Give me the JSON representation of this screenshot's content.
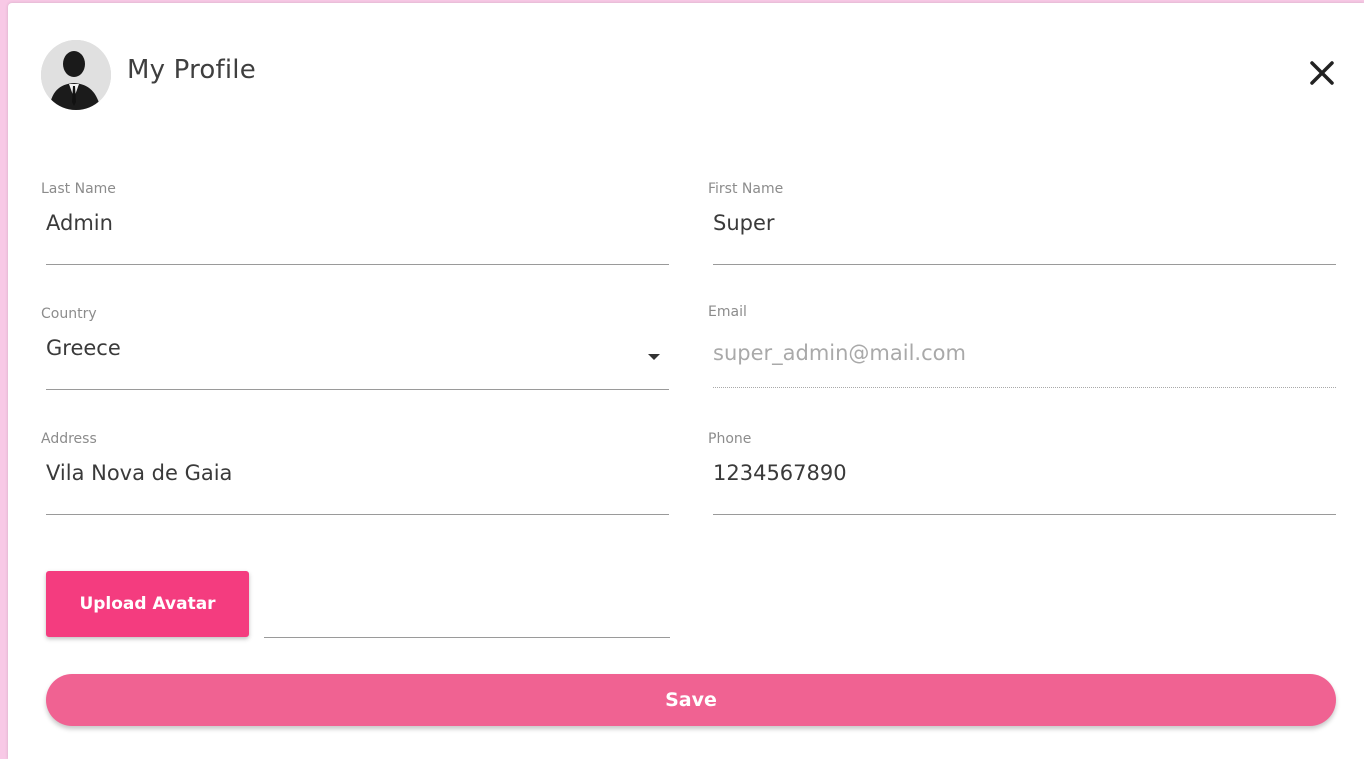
{
  "header": {
    "title": "My Profile"
  },
  "form": {
    "last_name": {
      "label": "Last Name",
      "value": "Admin"
    },
    "first_name": {
      "label": "First Name",
      "value": "Super"
    },
    "country": {
      "label": "Country",
      "value": "Greece"
    },
    "email": {
      "label": "Email",
      "value": "super_admin@mail.com",
      "disabled": true
    },
    "address": {
      "label": "Address",
      "value": "Vila Nova de Gaia"
    },
    "phone": {
      "label": "Phone",
      "value": "1234567890"
    }
  },
  "buttons": {
    "upload_label": "Upload Avatar",
    "save_label": "Save"
  },
  "icons": {
    "close": "close-icon",
    "avatar": "user-avatar",
    "dropdown": "dropdown-caret-icon"
  },
  "colors": {
    "accent": "#f43c7f",
    "save": "#f06292",
    "page_background": "#f8c9e6"
  }
}
